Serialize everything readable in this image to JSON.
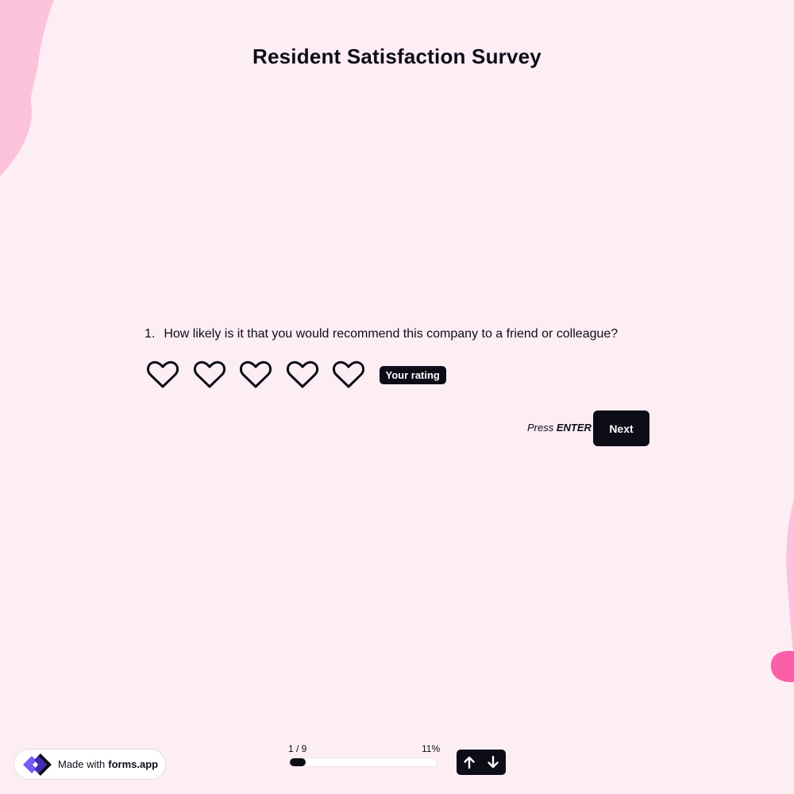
{
  "survey": {
    "title": "Resident Satisfaction Survey"
  },
  "question": {
    "number": "1.",
    "text": "How likely is it that you would recommend this company to a friend or colleague?",
    "rating_max": 5,
    "rating_value": 0,
    "rating_badge": "Your rating",
    "icon": "heart-outline-icon"
  },
  "actions": {
    "press_prefix": "Press",
    "press_key": "ENTER",
    "next_label": "Next"
  },
  "footer": {
    "made_with_prefix": "Made with",
    "made_with_brand": "forms.app",
    "progress_counter": "1 / 9",
    "progress_percent": "11%",
    "progress_fraction": 0.11
  },
  "colors": {
    "background": "#fdeef4",
    "accent": "#0d0d18",
    "blob_light": "#fcc2db",
    "blob_strong": "#fb5fa7",
    "logo_primary": "#7a5af8"
  }
}
